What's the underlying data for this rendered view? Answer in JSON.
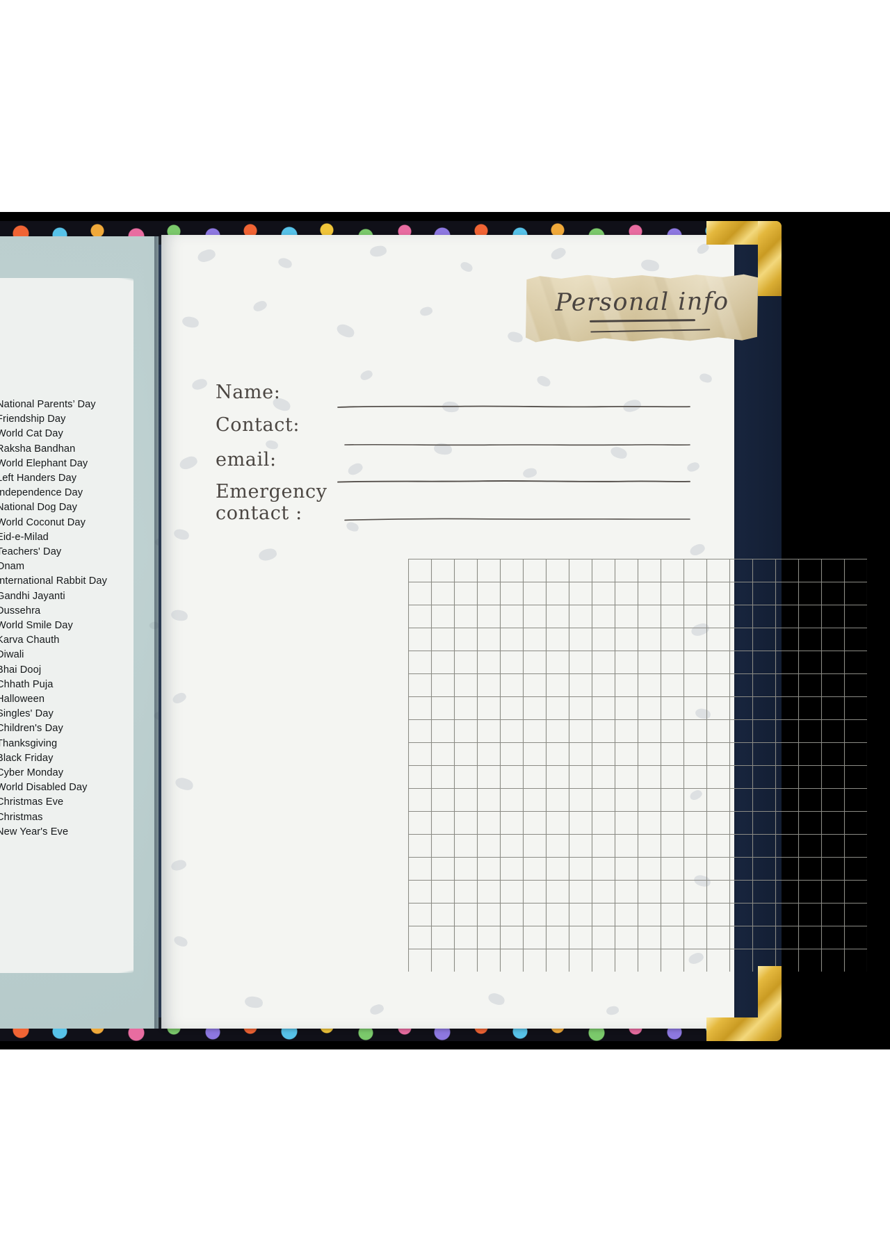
{
  "book": {
    "cover_color": "#223352",
    "gold_corner_color": "#d9ad33",
    "page_color": "#f4f5f2"
  },
  "left_page": {
    "name": "special-days-list",
    "wash_color": "#bdd0d0",
    "items": [
      "National Parents’ Day",
      "Friendship Day",
      "World Cat Day",
      "Raksha Bandhan",
      "World Elephant Day",
      "Left Handers Day",
      "Independence Day",
      "National Dog Day",
      "World Coconut Day",
      "Eid-e-Milad",
      "Teachers' Day",
      "Onam",
      "International Rabbit Day",
      "Gandhi Jayanti",
      "Dussehra",
      "World Smile Day",
      "Karva Chauth",
      "Diwali",
      "Bhai Dooj",
      "Chhath Puja",
      "Halloween",
      "Singles' Day",
      "Children's Day",
      "Thanksgiving",
      "Black Friday",
      "Cyber Monday",
      "World Disabled Day",
      "Christmas Eve",
      "Christmas",
      "New Year's Eve"
    ]
  },
  "right_page": {
    "tape": {
      "title": "Personal info",
      "tape_color": "#d9c79a",
      "ink_color": "#4a4440"
    },
    "fields": [
      {
        "label": "Name:",
        "value": "",
        "placeholder": ""
      },
      {
        "label": "Contact:",
        "value": "",
        "placeholder": ""
      },
      {
        "label": "email:",
        "value": "",
        "placeholder": ""
      },
      {
        "label": "Emergency\ncontact :",
        "value": "",
        "placeholder": ""
      }
    ],
    "grid": {
      "label": "notes-grid",
      "columns": 20,
      "rows": 18,
      "cell_size_px": 33,
      "line_color": "#8b8b85"
    }
  }
}
